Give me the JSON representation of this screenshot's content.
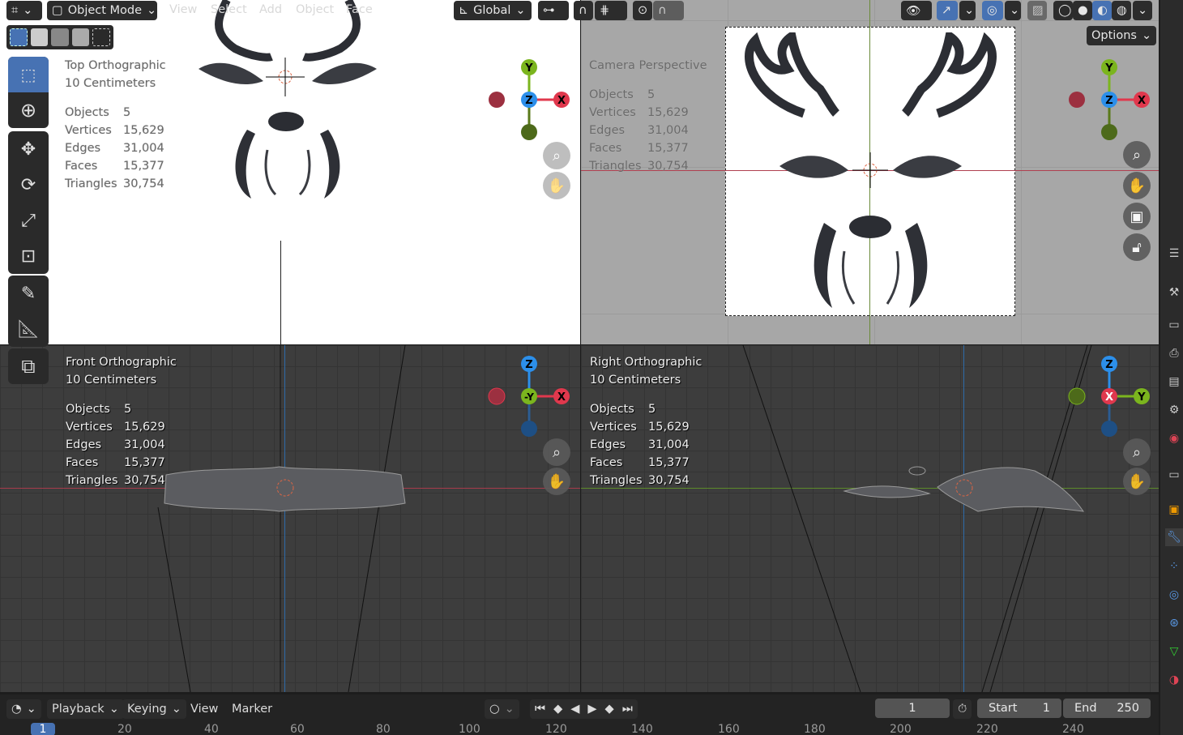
{
  "header": {
    "mode": "Object Mode",
    "menus": [
      "View",
      "Select",
      "Add",
      "Object",
      "Face"
    ],
    "orientation": "Global",
    "options": "Options"
  },
  "viewports": {
    "top": {
      "title": "Top Orthographic",
      "scale": "10 Centimeters"
    },
    "camera": {
      "title": "Camera Perspective"
    },
    "front": {
      "title": "Front Orthographic",
      "scale": "10 Centimeters"
    },
    "right": {
      "title": "Right Orthographic",
      "scale": "10 Centimeters"
    }
  },
  "stats": {
    "labels": {
      "objects": "Objects",
      "vertices": "Vertices",
      "edges": "Edges",
      "faces": "Faces",
      "triangles": "Triangles"
    },
    "values": {
      "objects": "5",
      "vertices": "15,629",
      "edges": "31,004",
      "faces": "15,377",
      "triangles": "30,754"
    }
  },
  "gizmo": {
    "x": "X",
    "y": "Y",
    "z": "Z",
    "neg_y": "-Y"
  },
  "timeline": {
    "playback": "Playback",
    "keying": "Keying",
    "view": "View",
    "marker": "Marker",
    "current_frame": "1",
    "start_label": "Start",
    "start": "1",
    "end_label": "End",
    "end": "250",
    "ruler": [
      "1",
      "20",
      "40",
      "60",
      "80",
      "100",
      "120",
      "140",
      "160",
      "180",
      "200",
      "220",
      "240"
    ]
  },
  "colors": {
    "x": "#e0384d",
    "y": "#7bb51e",
    "z": "#2c8fea",
    "accent": "#4772b3"
  }
}
